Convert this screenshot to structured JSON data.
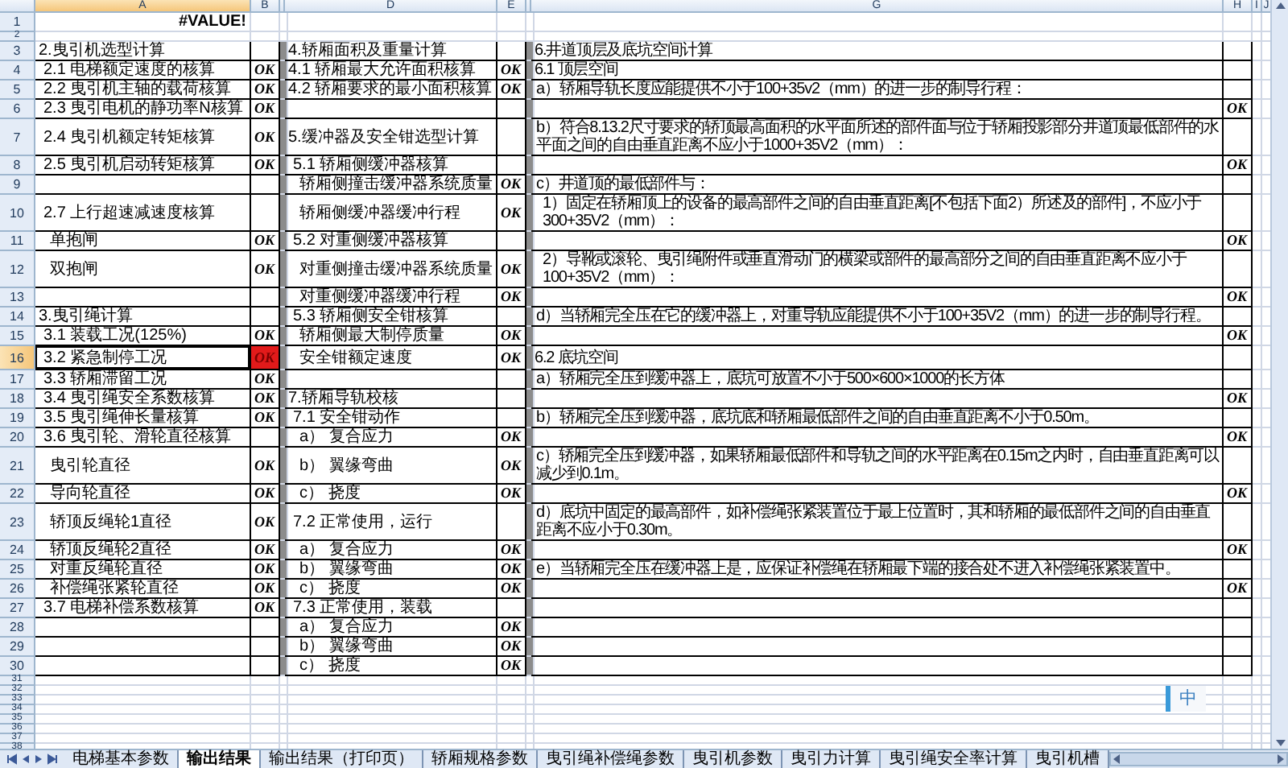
{
  "column_headers": [
    {
      "label": "A",
      "selected": true
    },
    {
      "label": "B",
      "selected": false
    },
    {
      "label": "D",
      "selected": false
    },
    {
      "label": "E",
      "selected": false
    },
    {
      "label": "G",
      "selected": false
    },
    {
      "label": "H",
      "selected": false
    },
    {
      "label": "I",
      "selected": false
    },
    {
      "label": "J",
      "selected": false
    }
  ],
  "rows": [
    {
      "n": "1",
      "selected": false,
      "a": {
        "text": "#VALUE!",
        "kind": "title"
      }
    },
    {
      "n": "2",
      "selected": false
    },
    {
      "n": "3",
      "selected": false,
      "a": {
        "text": "2.曳引机选型计算",
        "kind": "section"
      },
      "d": {
        "text": "4.轿厢面积及重量计算",
        "kind": "section"
      },
      "g": {
        "text": "6.井道顶层及底坑空间计算",
        "kind": "section"
      }
    },
    {
      "n": "4",
      "selected": false,
      "error": false,
      "a": {
        "text": "2.1 电梯额定速度的核算",
        "kind": "item"
      },
      "b": "OK",
      "d": {
        "text": "4.1 轿厢最大允许面积核算",
        "kind": "section"
      },
      "e": "OK",
      "g": {
        "text": "6.1 顶层空间",
        "kind": "section"
      }
    },
    {
      "n": "5",
      "selected": false,
      "error": false,
      "a": {
        "text": "2.2 曳引机主轴的载荷核算",
        "kind": "item"
      },
      "b": "OK",
      "d": {
        "text": "4.2 轿厢要求的最小面积核算",
        "kind": "section"
      },
      "e": "OK",
      "g": {
        "text": "a）轿厢导轨长度应能提供不小于100+35v2（mm）的进一步的制导行程：",
        "kind": "item"
      }
    },
    {
      "n": "6",
      "selected": false,
      "error": false,
      "a": {
        "text": "2.3 曳引电机的静功率N核算",
        "kind": "item"
      },
      "b": "OK",
      "h": "OK"
    },
    {
      "n": "7",
      "selected": false,
      "error": false,
      "a": {
        "text": "2.4 曳引机额定转矩核算",
        "kind": "item"
      },
      "b": "OK",
      "d": {
        "text": "5.缓冲器及安全钳选型计算",
        "kind": "section"
      },
      "g": {
        "text": "b）符合8.13.2尺寸要求的轿顶最高面积的水平面所述的部件面与位于轿厢投影部分井道顶最低部件的水平面之间的自由垂直距离不应小于1000+35V2（mm）：",
        "kind": "item"
      }
    },
    {
      "n": "8",
      "selected": false,
      "error": false,
      "a": {
        "text": "2.5 曳引机启动转矩核算",
        "kind": "item"
      },
      "b": "OK",
      "d": {
        "text": "5.1 轿厢侧缓冲器核算",
        "kind": "item"
      },
      "h": "OK"
    },
    {
      "n": "9",
      "selected": false,
      "d": {
        "text": "轿厢侧撞击缓冲器系统质量",
        "kind": "sub"
      },
      "e": "OK",
      "g": {
        "text": "c）井道顶的最低部件与：",
        "kind": "item"
      }
    },
    {
      "n": "10",
      "selected": false,
      "a": {
        "text": "2.7 上行超速减速度核算",
        "kind": "item"
      },
      "d": {
        "text": "轿厢侧缓冲器缓冲行程",
        "kind": "sub"
      },
      "e": "OK",
      "g": {
        "text": "1）固定在轿厢顶上的设备的最高部件之间的自由垂直距离[不包括下面2）所述及的部件]，不应小于300+35V2（mm）：",
        "kind": "sub"
      }
    },
    {
      "n": "11",
      "selected": false,
      "error": false,
      "a": {
        "text": "单抱闸",
        "kind": "sub"
      },
      "b": "OK",
      "d": {
        "text": "5.2 对重侧缓冲器核算",
        "kind": "item"
      },
      "h": "OK"
    },
    {
      "n": "12",
      "selected": false,
      "error": false,
      "a": {
        "text": "双抱闸",
        "kind": "sub"
      },
      "b": "OK",
      "d": {
        "text": "对重侧撞击缓冲器系统质量",
        "kind": "sub"
      },
      "e": "OK",
      "g": {
        "text": "2）导靴或滚轮、曳引绳附件或垂直滑动门的横梁或部件的最高部分之间的自由垂直距离不应小于100+35V2（mm）：",
        "kind": "sub"
      }
    },
    {
      "n": "13",
      "selected": false,
      "d": {
        "text": "对重侧缓冲器缓冲行程",
        "kind": "sub"
      },
      "e": "OK",
      "h": "OK"
    },
    {
      "n": "14",
      "selected": false,
      "a": {
        "text": "3.曳引绳计算",
        "kind": "section"
      },
      "d": {
        "text": "5.3 轿厢侧安全钳核算",
        "kind": "item"
      },
      "g": {
        "text": "d）当轿厢完全压在它的缓冲器上，对重导轨应能提供不小于100+35V2（mm）的进一步的制导行程。",
        "kind": "item"
      }
    },
    {
      "n": "15",
      "selected": false,
      "error": false,
      "a": {
        "text": "3.1 装载工况(125%)",
        "kind": "item"
      },
      "b": "OK",
      "d": {
        "text": "轿厢侧最大制停质量",
        "kind": "sub"
      },
      "e": "OK",
      "h": "OK"
    },
    {
      "n": "16",
      "selected": true,
      "error": true,
      "a": {
        "text": "3.2 紧急制停工况",
        "kind": "item"
      },
      "b": "OK",
      "d": {
        "text": "安全钳额定速度",
        "kind": "sub"
      },
      "e": "OK",
      "g": {
        "text": "6.2 底坑空间",
        "kind": "section"
      }
    },
    {
      "n": "17",
      "selected": false,
      "error": false,
      "a": {
        "text": "3.3 轿厢滞留工况",
        "kind": "item"
      },
      "b": "OK",
      "g": {
        "text": "a）轿厢完全压到缓冲器上，底坑可放置不小于500×600×1000的长方体",
        "kind": "item"
      }
    },
    {
      "n": "18",
      "selected": false,
      "error": false,
      "a": {
        "text": "3.4 曳引绳安全系数核算",
        "kind": "item"
      },
      "b": "OK",
      "d": {
        "text": "7.轿厢导轨校核",
        "kind": "section"
      },
      "h": "OK"
    },
    {
      "n": "19",
      "selected": false,
      "error": false,
      "a": {
        "text": "3.5 曳引绳伸长量核算",
        "kind": "item"
      },
      "b": "OK",
      "d": {
        "text": "7.1 安全钳动作",
        "kind": "item"
      },
      "g": {
        "text": "b）轿厢完全压到缓冲器，底坑底和轿厢最低部件之间的自由垂直距离不小于0.50m。",
        "kind": "item"
      }
    },
    {
      "n": "20",
      "selected": false,
      "a": {
        "text": "3.6 曳引轮、滑轮直径核算",
        "kind": "item"
      },
      "d": {
        "text": "a） 复合应力",
        "kind": "sub"
      },
      "e": "OK",
      "h": "OK"
    },
    {
      "n": "21",
      "selected": false,
      "error": false,
      "a": {
        "text": "曳引轮直径",
        "kind": "sub"
      },
      "b": "OK",
      "d": {
        "text": "b） 翼缘弯曲",
        "kind": "sub"
      },
      "e": "OK",
      "g": {
        "text": "c）轿厢完全压到缓冲器，如果轿厢最低部件和导轨之间的水平距离在0.15m之内时，自由垂直距离可以减少到0.1m。",
        "kind": "item"
      }
    },
    {
      "n": "22",
      "selected": false,
      "error": false,
      "a": {
        "text": "导向轮直径",
        "kind": "sub"
      },
      "b": "OK",
      "d": {
        "text": "c） 挠度",
        "kind": "sub"
      },
      "e": "OK",
      "h": "OK"
    },
    {
      "n": "23",
      "selected": false,
      "error": false,
      "a": {
        "text": "轿顶反绳轮1直径",
        "kind": "sub"
      },
      "b": "OK",
      "d": {
        "text": "7.2 正常使用，运行",
        "kind": "item"
      },
      "g": {
        "text": "d）底坑中固定的最高部件，如补偿绳张紧装置位于最上位置时，其和轿厢的最低部件之间的自由垂直距离不应小于0.30m。",
        "kind": "item"
      }
    },
    {
      "n": "24",
      "selected": false,
      "error": false,
      "a": {
        "text": "轿顶反绳轮2直径",
        "kind": "sub"
      },
      "b": "OK",
      "d": {
        "text": "a） 复合应力",
        "kind": "sub"
      },
      "e": "OK",
      "h": "OK"
    },
    {
      "n": "25",
      "selected": false,
      "error": false,
      "a": {
        "text": "对重反绳轮直径",
        "kind": "sub"
      },
      "b": "OK",
      "d": {
        "text": "b） 翼缘弯曲",
        "kind": "sub"
      },
      "e": "OK",
      "g": {
        "text": "e）当轿厢完全压在缓冲器上是，应保证补偿绳在轿厢最下端的接合处不进入补偿绳张紧装置中。",
        "kind": "item"
      }
    },
    {
      "n": "26",
      "selected": false,
      "error": false,
      "a": {
        "text": "补偿绳张紧轮直径",
        "kind": "sub"
      },
      "b": "OK",
      "d": {
        "text": "c） 挠度",
        "kind": "sub"
      },
      "e": "OK",
      "h": "OK"
    },
    {
      "n": "27",
      "selected": false,
      "error": false,
      "a": {
        "text": "3.7 电梯补偿系数核算",
        "kind": "item"
      },
      "b": "OK",
      "d": {
        "text": "7.3 正常使用，装载",
        "kind": "item"
      }
    },
    {
      "n": "28",
      "selected": false,
      "d": {
        "text": "a） 复合应力",
        "kind": "sub"
      },
      "e": "OK"
    },
    {
      "n": "29",
      "selected": false,
      "d": {
        "text": "b） 翼缘弯曲",
        "kind": "sub"
      },
      "e": "OK"
    },
    {
      "n": "30",
      "selected": false,
      "d": {
        "text": "c） 挠度",
        "kind": "sub"
      },
      "e": "OK"
    },
    {
      "n": "31",
      "selected": false
    },
    {
      "n": "32",
      "selected": false
    },
    {
      "n": "33",
      "selected": false
    },
    {
      "n": "34",
      "selected": false
    },
    {
      "n": "35",
      "selected": false
    },
    {
      "n": "36",
      "selected": false
    },
    {
      "n": "37",
      "selected": false
    },
    {
      "n": "38",
      "selected": false
    }
  ],
  "ime_indicator": "中",
  "sheet_tabs": [
    {
      "label": "电梯基本参数",
      "selected": false
    },
    {
      "label": "输出结果",
      "selected": true
    },
    {
      "label": "输出结果（打印页）",
      "selected": false
    },
    {
      "label": "轿厢规格参数",
      "selected": false
    },
    {
      "label": "曳引绳补偿绳参数",
      "selected": false
    },
    {
      "label": "曳引机参数",
      "selected": false
    },
    {
      "label": "曳引力计算",
      "selected": false
    },
    {
      "label": "曳引绳安全率计算",
      "selected": false
    },
    {
      "label": "曳引机槽",
      "selected": false
    }
  ]
}
